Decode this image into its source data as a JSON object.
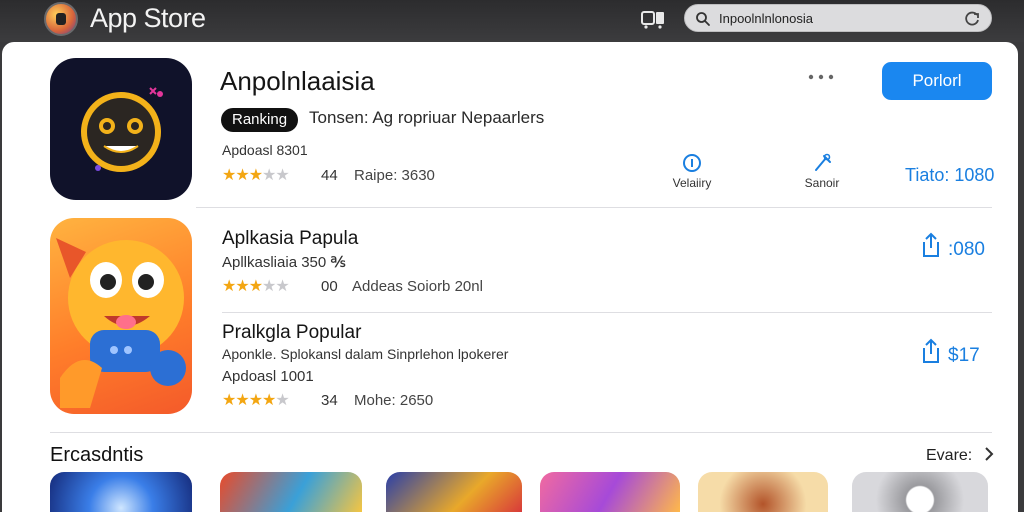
{
  "app": {
    "title": "App Store"
  },
  "search": {
    "value": "Inpoolnlnlonosia"
  },
  "featured": {
    "name": "Anpolnlaaisia",
    "badge": "Ranking",
    "subtitle": "Tonsen: Ag ropriuar Nepaarlers",
    "meta": "Apdoasl 8301",
    "rating": 3,
    "rating_max": 5,
    "rating_count": "44",
    "rating_label": "Raipe: 3630",
    "get_label": "Porlorl",
    "stats": [
      {
        "icon": "info-icon",
        "label": "Velaiiry"
      },
      {
        "icon": "tools-icon",
        "label": "Sanoir"
      }
    ],
    "price": "Tiato: 1080"
  },
  "list": [
    {
      "name": "Aplkasia Papula",
      "sub": "Apllkasliaia 350 ℁",
      "rating": 3,
      "rating_max": 5,
      "rating_count": "00",
      "rating_label": "Addeas Soiorb 20nl",
      "price": ":080"
    },
    {
      "name": "Pralkgla Popular",
      "sub": "Aponkle. Splokansl dalam Sinprlehon lpokerer",
      "meta": "Apdoasl 1001",
      "rating": 4,
      "rating_max": 5,
      "rating_count": "34",
      "rating_label": "Mohe: 2650",
      "price": "$17"
    }
  ],
  "section": {
    "title": "Ercasdntis",
    "see_all": "Evare:"
  },
  "colors": {
    "accent": "#1a87f0",
    "star": "#f3a612",
    "topbar": "#2c2c2e"
  }
}
